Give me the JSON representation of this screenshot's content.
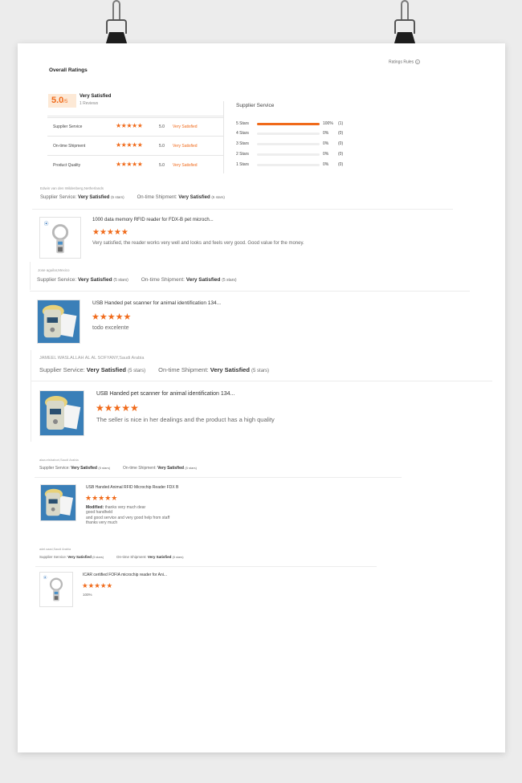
{
  "header": {
    "title": "Overall Ratings",
    "rules_label": "Ratings Rules",
    "rules_icon": "?"
  },
  "overall": {
    "score": "5.0",
    "scale": "/5",
    "label": "Very Satisfied",
    "reviews": "1 Reviews"
  },
  "summary": [
    {
      "label": "Supplier Service",
      "stars": "★★★★★",
      "value": "5.0",
      "text": "Very Satisfied"
    },
    {
      "label": "On-time Shipment",
      "stars": "★★★★★",
      "value": "5.0",
      "text": "Very Satisfied"
    },
    {
      "label": "Product Quality",
      "stars": "★★★★★",
      "value": "5.0",
      "text": "Very Satisfied"
    }
  ],
  "distribution": {
    "title": "Supplier Service",
    "rows": [
      {
        "label": "5 Stars",
        "fraction": 1.0,
        "percent": "100%",
        "count": "(1)"
      },
      {
        "label": "4 Stars",
        "fraction": 0,
        "percent": "0%",
        "count": "(0)"
      },
      {
        "label": "3 Stars",
        "fraction": 0,
        "percent": "0%",
        "count": "(0)"
      },
      {
        "label": "2 Stars",
        "fraction": 0,
        "percent": "0%",
        "count": "(0)"
      },
      {
        "label": "1 Stars",
        "fraction": 0,
        "percent": "0%",
        "count": "(0)"
      }
    ]
  },
  "labels": {
    "supplier_service": "Supplier Service:",
    "ontime_shipment": "On-time Shipment:",
    "rating": "Very Satisfied",
    "stars_note": "(5 stars)",
    "modified": "Modified:"
  },
  "reviews": [
    {
      "reviewer": "Edwin van den Wildenberg,Netherlands",
      "product": "1000 data memory RFID reader for FDX-B pet microch...",
      "stars": "★★★★★",
      "text": "Very satisfied, the reader works very well and looks and feels very good. Good value for the money.",
      "image": "reader"
    },
    {
      "reviewer": "Jose aguilar,Mexico",
      "product": "USB Handed pet scanner for animal identification 134...",
      "stars": "★★★★★",
      "text": "todo excelente",
      "image": "scanner"
    },
    {
      "reviewer": "JAMEEL WASLALLAH AL AL SOFYANY,Saudi Arabia",
      "product": "USB Handed pet scanner for animal identification 134...",
      "stars": "★★★★★",
      "text": "The seller is nice in her dealings and the product has a high quality",
      "image": "scanner"
    },
    {
      "reviewer": "alaa.elshabori,Saudi Arabia",
      "product": "USB Handed Animal RFID Microchip Reader FDX B",
      "stars": "★★★★★",
      "text_lines": [
        "thanks very much dear",
        "good handheld",
        "and good service and very good help from staff",
        "thanks very much"
      ],
      "image": "scanner"
    },
    {
      "reviewer": "adel.saad,Saudi Arabia",
      "product": "ICAR certified FOFIA microchip reader for Ani...",
      "stars": "★★★★★",
      "text": "100%",
      "image": "reader"
    }
  ],
  "colors": {
    "accent": "#f06a1a",
    "score_bg": "#fde9d6"
  }
}
